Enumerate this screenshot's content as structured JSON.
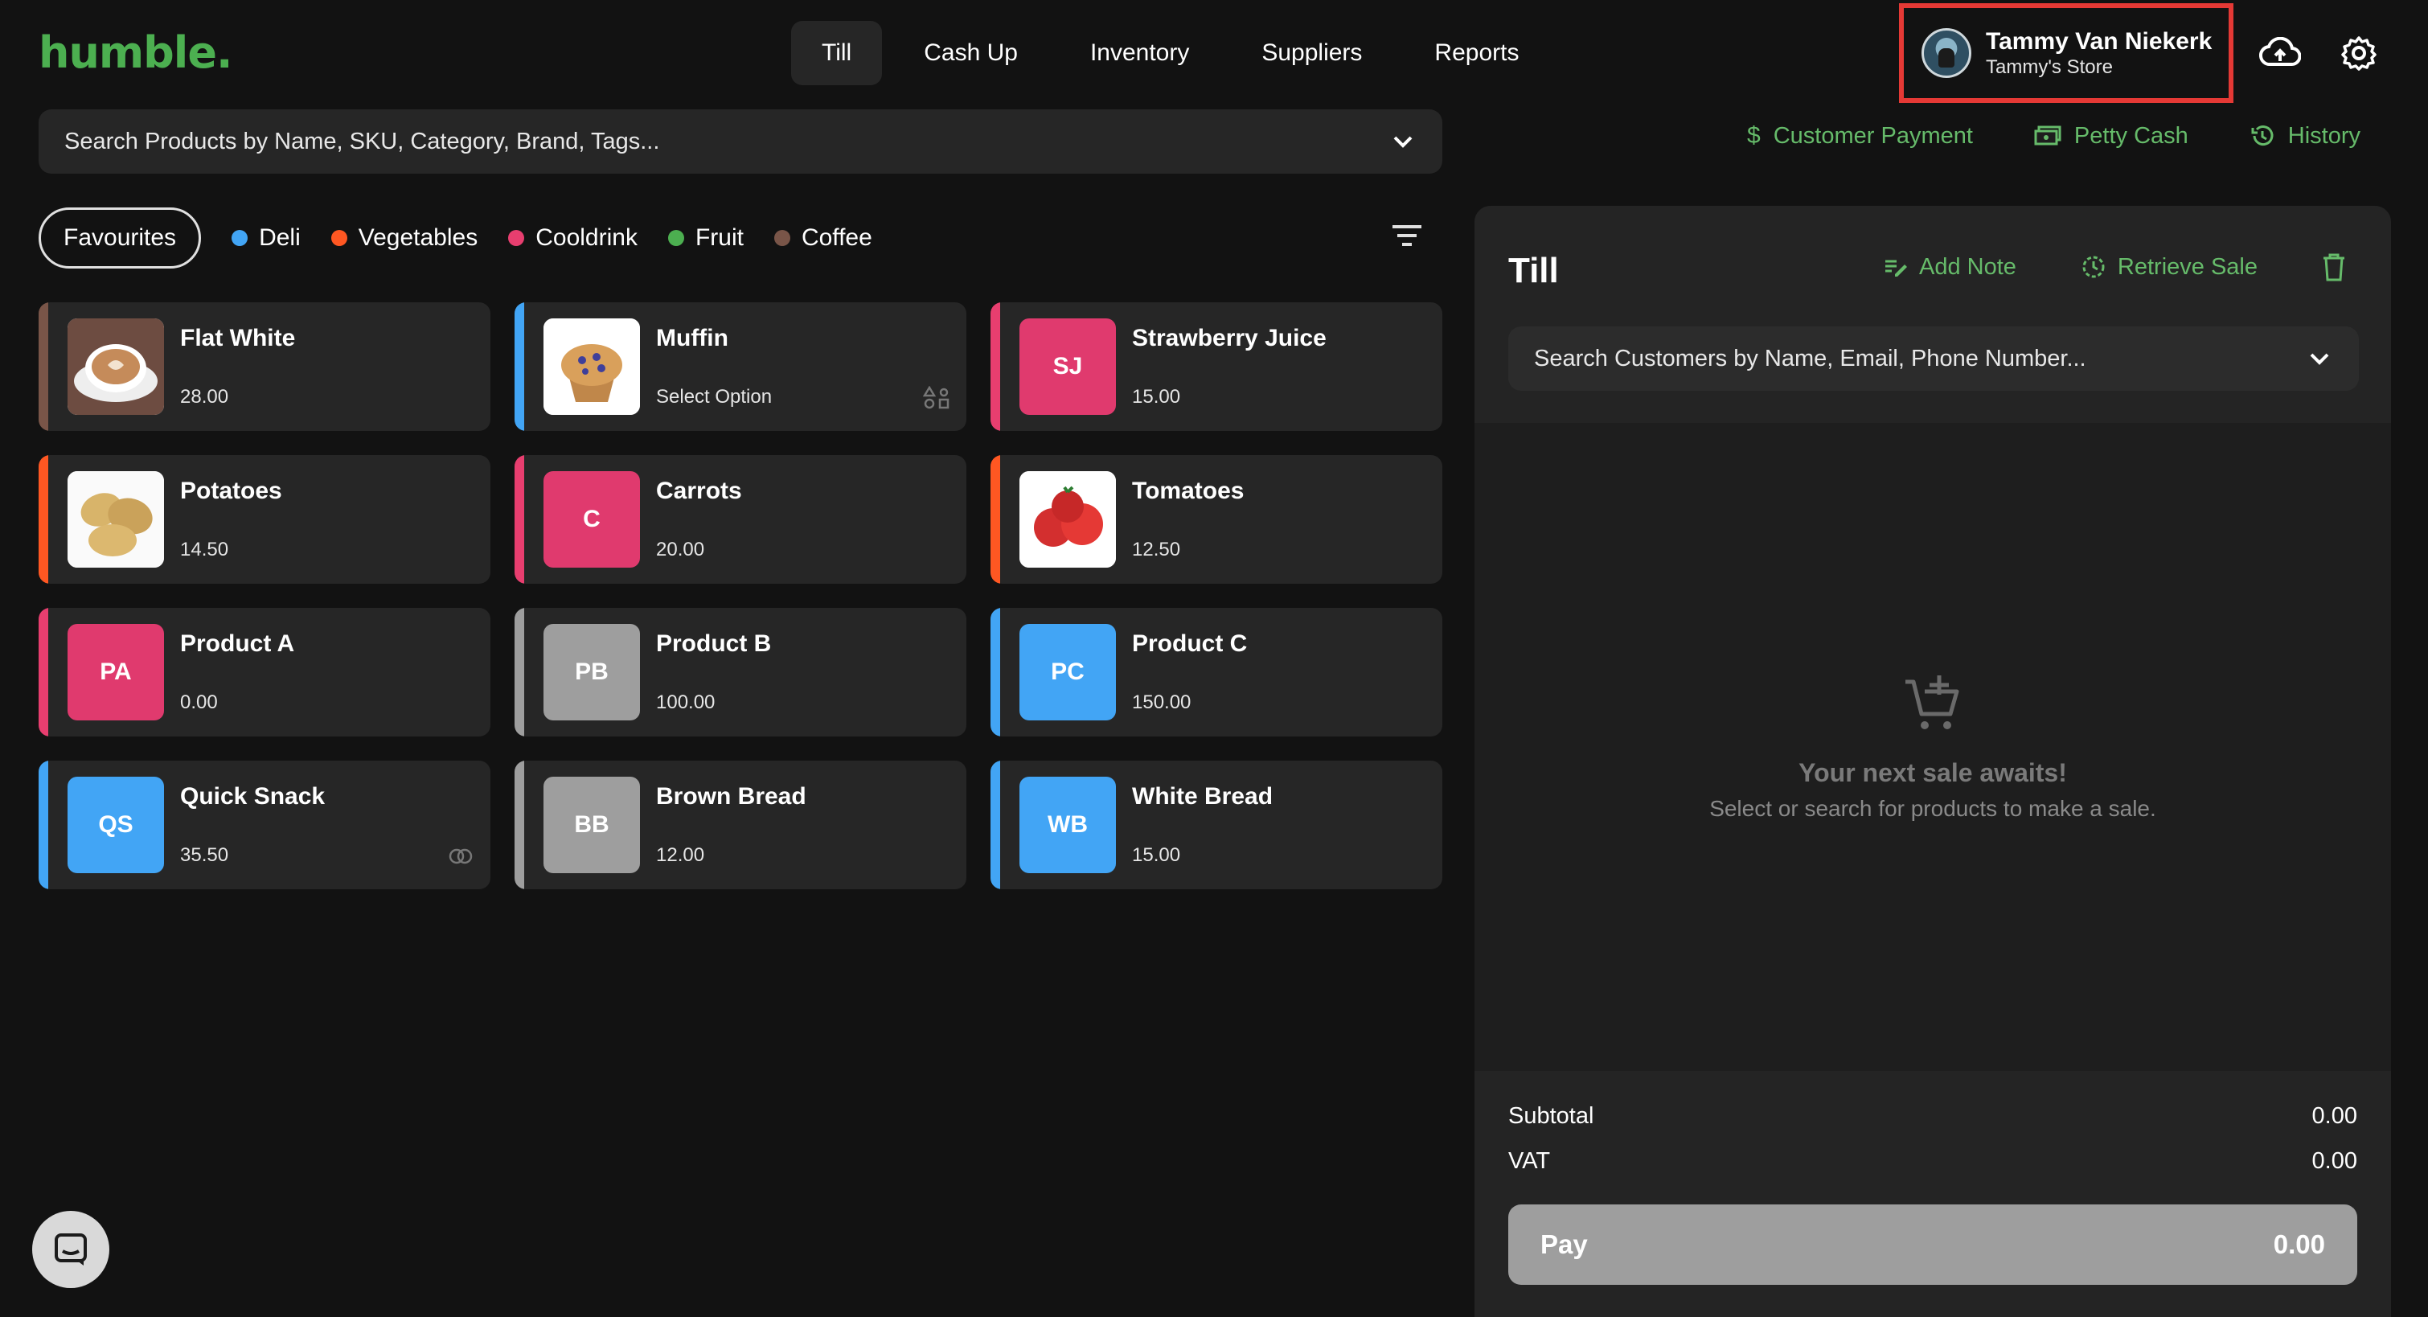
{
  "brand": {
    "logo": "humble.",
    "accent": "#4caf50",
    "link_color": "#66bb6a"
  },
  "nav": {
    "tabs": [
      {
        "label": "Till",
        "active": true
      },
      {
        "label": "Cash Up"
      },
      {
        "label": "Inventory"
      },
      {
        "label": "Suppliers"
      },
      {
        "label": "Reports"
      }
    ]
  },
  "user": {
    "name": "Tammy Van Niekerk",
    "store": "Tammy's Store",
    "highlight": "#e53935"
  },
  "icons": {
    "upload": "cloud-upload-icon",
    "settings": "gear-icon"
  },
  "product_search": {
    "placeholder": "Search Products by Name, SKU, Category, Brand, Tags..."
  },
  "quick_links": {
    "customer_payment": "Customer Payment",
    "petty_cash": "Petty Cash",
    "history": "History"
  },
  "categories": [
    {
      "label": "Favourites",
      "selected": true
    },
    {
      "label": "Deli",
      "color": "#42a5f5"
    },
    {
      "label": "Vegetables",
      "color": "#ff5722"
    },
    {
      "label": "Cooldrink",
      "color": "#e83e6f"
    },
    {
      "label": "Fruit",
      "color": "#4caf50"
    },
    {
      "label": "Coffee",
      "color": "#795548"
    }
  ],
  "products": [
    {
      "name": "Flat White",
      "price": "28.00",
      "bar": "#795548",
      "image": "coffee-cup"
    },
    {
      "name": "Muffin",
      "price": "Select Option",
      "bar": "#42a5f5",
      "image": "muffin",
      "badge": "variants-icon"
    },
    {
      "name": "Strawberry Juice",
      "price": "15.00",
      "bar": "#e83e6f",
      "initials": "SJ",
      "tile": "#e03a6e"
    },
    {
      "name": "Potatoes",
      "price": "14.50",
      "bar": "#ff5722",
      "image": "potatoes"
    },
    {
      "name": "Carrots",
      "price": "20.00",
      "bar": "#e83e6f",
      "initials": "C",
      "tile": "#e03a6e"
    },
    {
      "name": "Tomatoes",
      "price": "12.50",
      "bar": "#ff5722",
      "image": "tomatoes"
    },
    {
      "name": "Product A",
      "price": "0.00",
      "bar": "#e83e6f",
      "initials": "PA",
      "tile": "#e03a6e"
    },
    {
      "name": "Product B",
      "price": "100.00",
      "bar": "#9e9e9e",
      "initials": "PB",
      "tile": "#9e9e9e"
    },
    {
      "name": "Product C",
      "price": "150.00",
      "bar": "#42a5f5",
      "initials": "PC",
      "tile": "#42a5f5"
    },
    {
      "name": "Quick Snack",
      "price": "35.50",
      "bar": "#42a5f5",
      "initials": "QS",
      "tile": "#42a5f5",
      "badge": "combo-icon"
    },
    {
      "name": "Brown Bread",
      "price": "12.00",
      "bar": "#9e9e9e",
      "initials": "BB",
      "tile": "#9e9e9e"
    },
    {
      "name": "White Bread",
      "price": "15.00",
      "bar": "#42a5f5",
      "initials": "WB",
      "tile": "#42a5f5"
    }
  ],
  "till": {
    "title": "Till",
    "add_note": "Add Note",
    "retrieve_sale": "Retrieve Sale",
    "customer_search_placeholder": "Search Customers by Name, Email, Phone Number...",
    "empty_title": "Your next sale awaits!",
    "empty_subtitle": "Select or search for products to make a sale.",
    "subtotal_label": "Subtotal",
    "subtotal_value": "0.00",
    "vat_label": "VAT",
    "vat_value": "0.00",
    "pay_label": "Pay",
    "pay_value": "0.00"
  }
}
